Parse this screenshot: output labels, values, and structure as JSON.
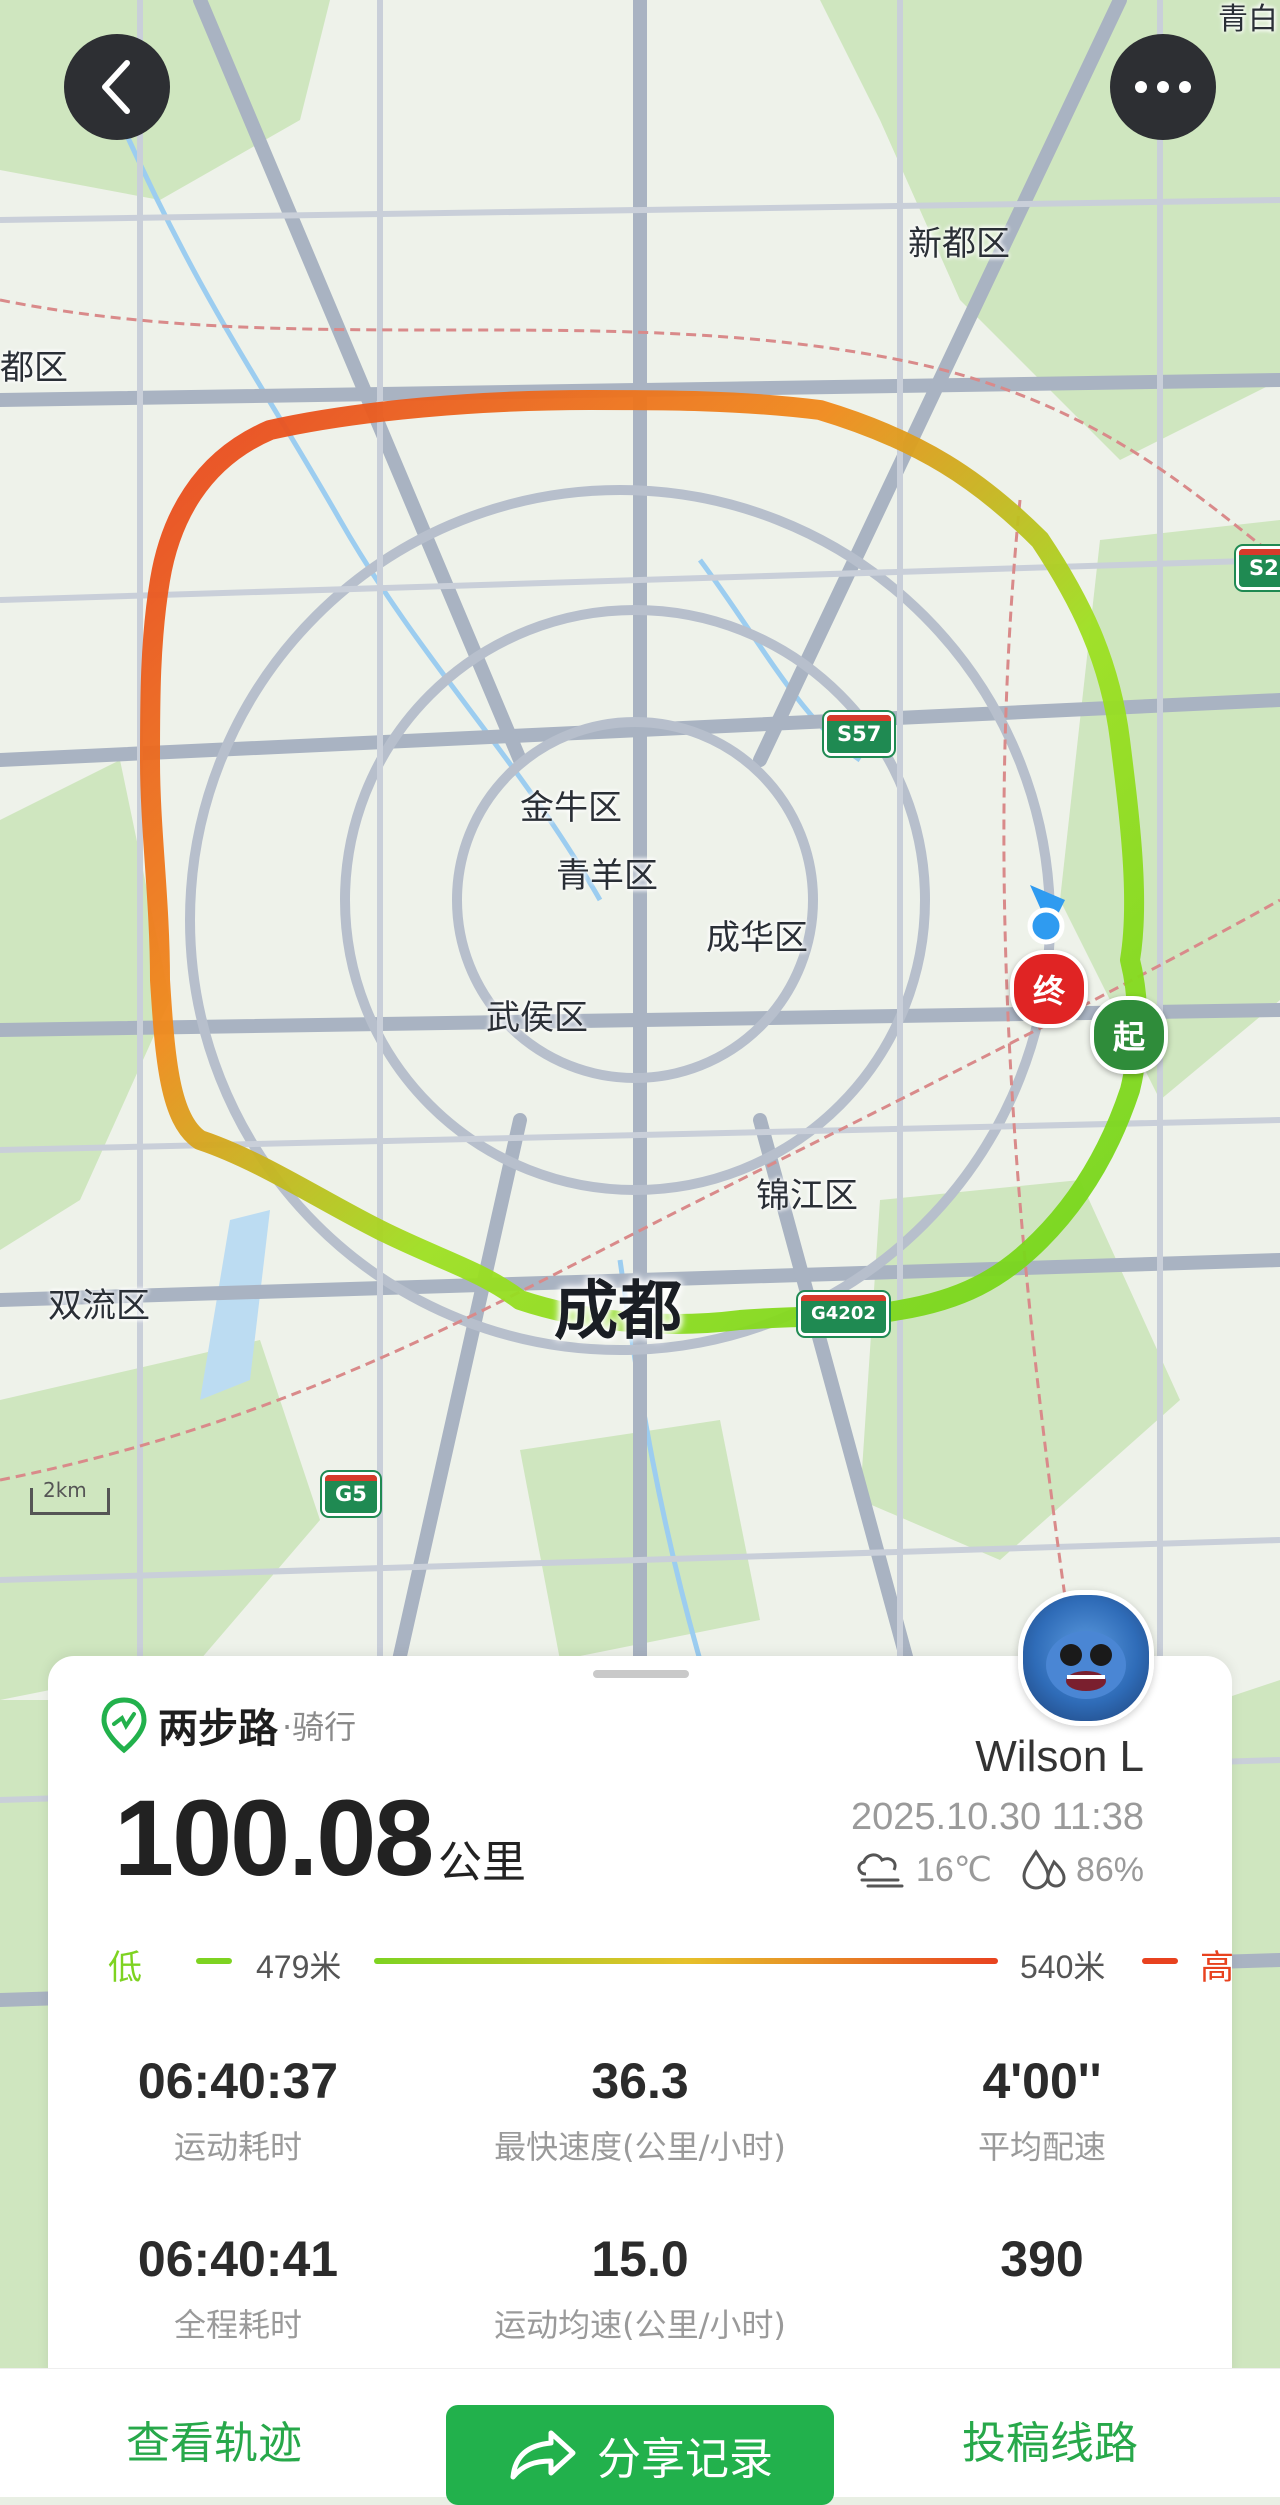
{
  "map": {
    "districts": [
      "新都区",
      "都区",
      "金牛区",
      "青羊区",
      "成华区",
      "武侯区",
      "锦江区",
      "双流区",
      "青白"
    ],
    "city": "成都",
    "highway_shields": [
      "S57",
      "S2",
      "G4202",
      "G5"
    ],
    "scale": "2km",
    "start_marker": "起",
    "end_marker": "终"
  },
  "top_bar": {
    "back_icon": "chevron-left-icon",
    "more_icon": "more-dots-icon"
  },
  "card": {
    "brand_name": "两步路",
    "brand_sub": "·骑行",
    "distance_value": "100.08",
    "distance_unit": "公里",
    "user_name": "Wilson L",
    "record_time": "2025.10.30 11:38",
    "temperature": "16℃",
    "humidity": "86%",
    "elevation": {
      "low_label": "低",
      "low_value": "479米",
      "high_value": "540米",
      "high_label": "高"
    },
    "stats": [
      {
        "value": "06:40:37",
        "label": "运动耗时"
      },
      {
        "value": "36.3",
        "label": "最快速度(公里/小时)"
      },
      {
        "value": "4'00''",
        "label": "平均配速"
      },
      {
        "value": "06:40:41",
        "label": "全程耗时"
      },
      {
        "value": "15.0",
        "label": "运动均速(公里/小时)"
      },
      {
        "value": "390",
        "label": ""
      }
    ]
  },
  "bottom_bar": {
    "view_track": "查看轨迹",
    "share_record": "分享记录",
    "submit_route": "投稿线路"
  },
  "colors": {
    "accent": "#22b14c",
    "low": "#7ed321",
    "high": "#e8421f"
  }
}
